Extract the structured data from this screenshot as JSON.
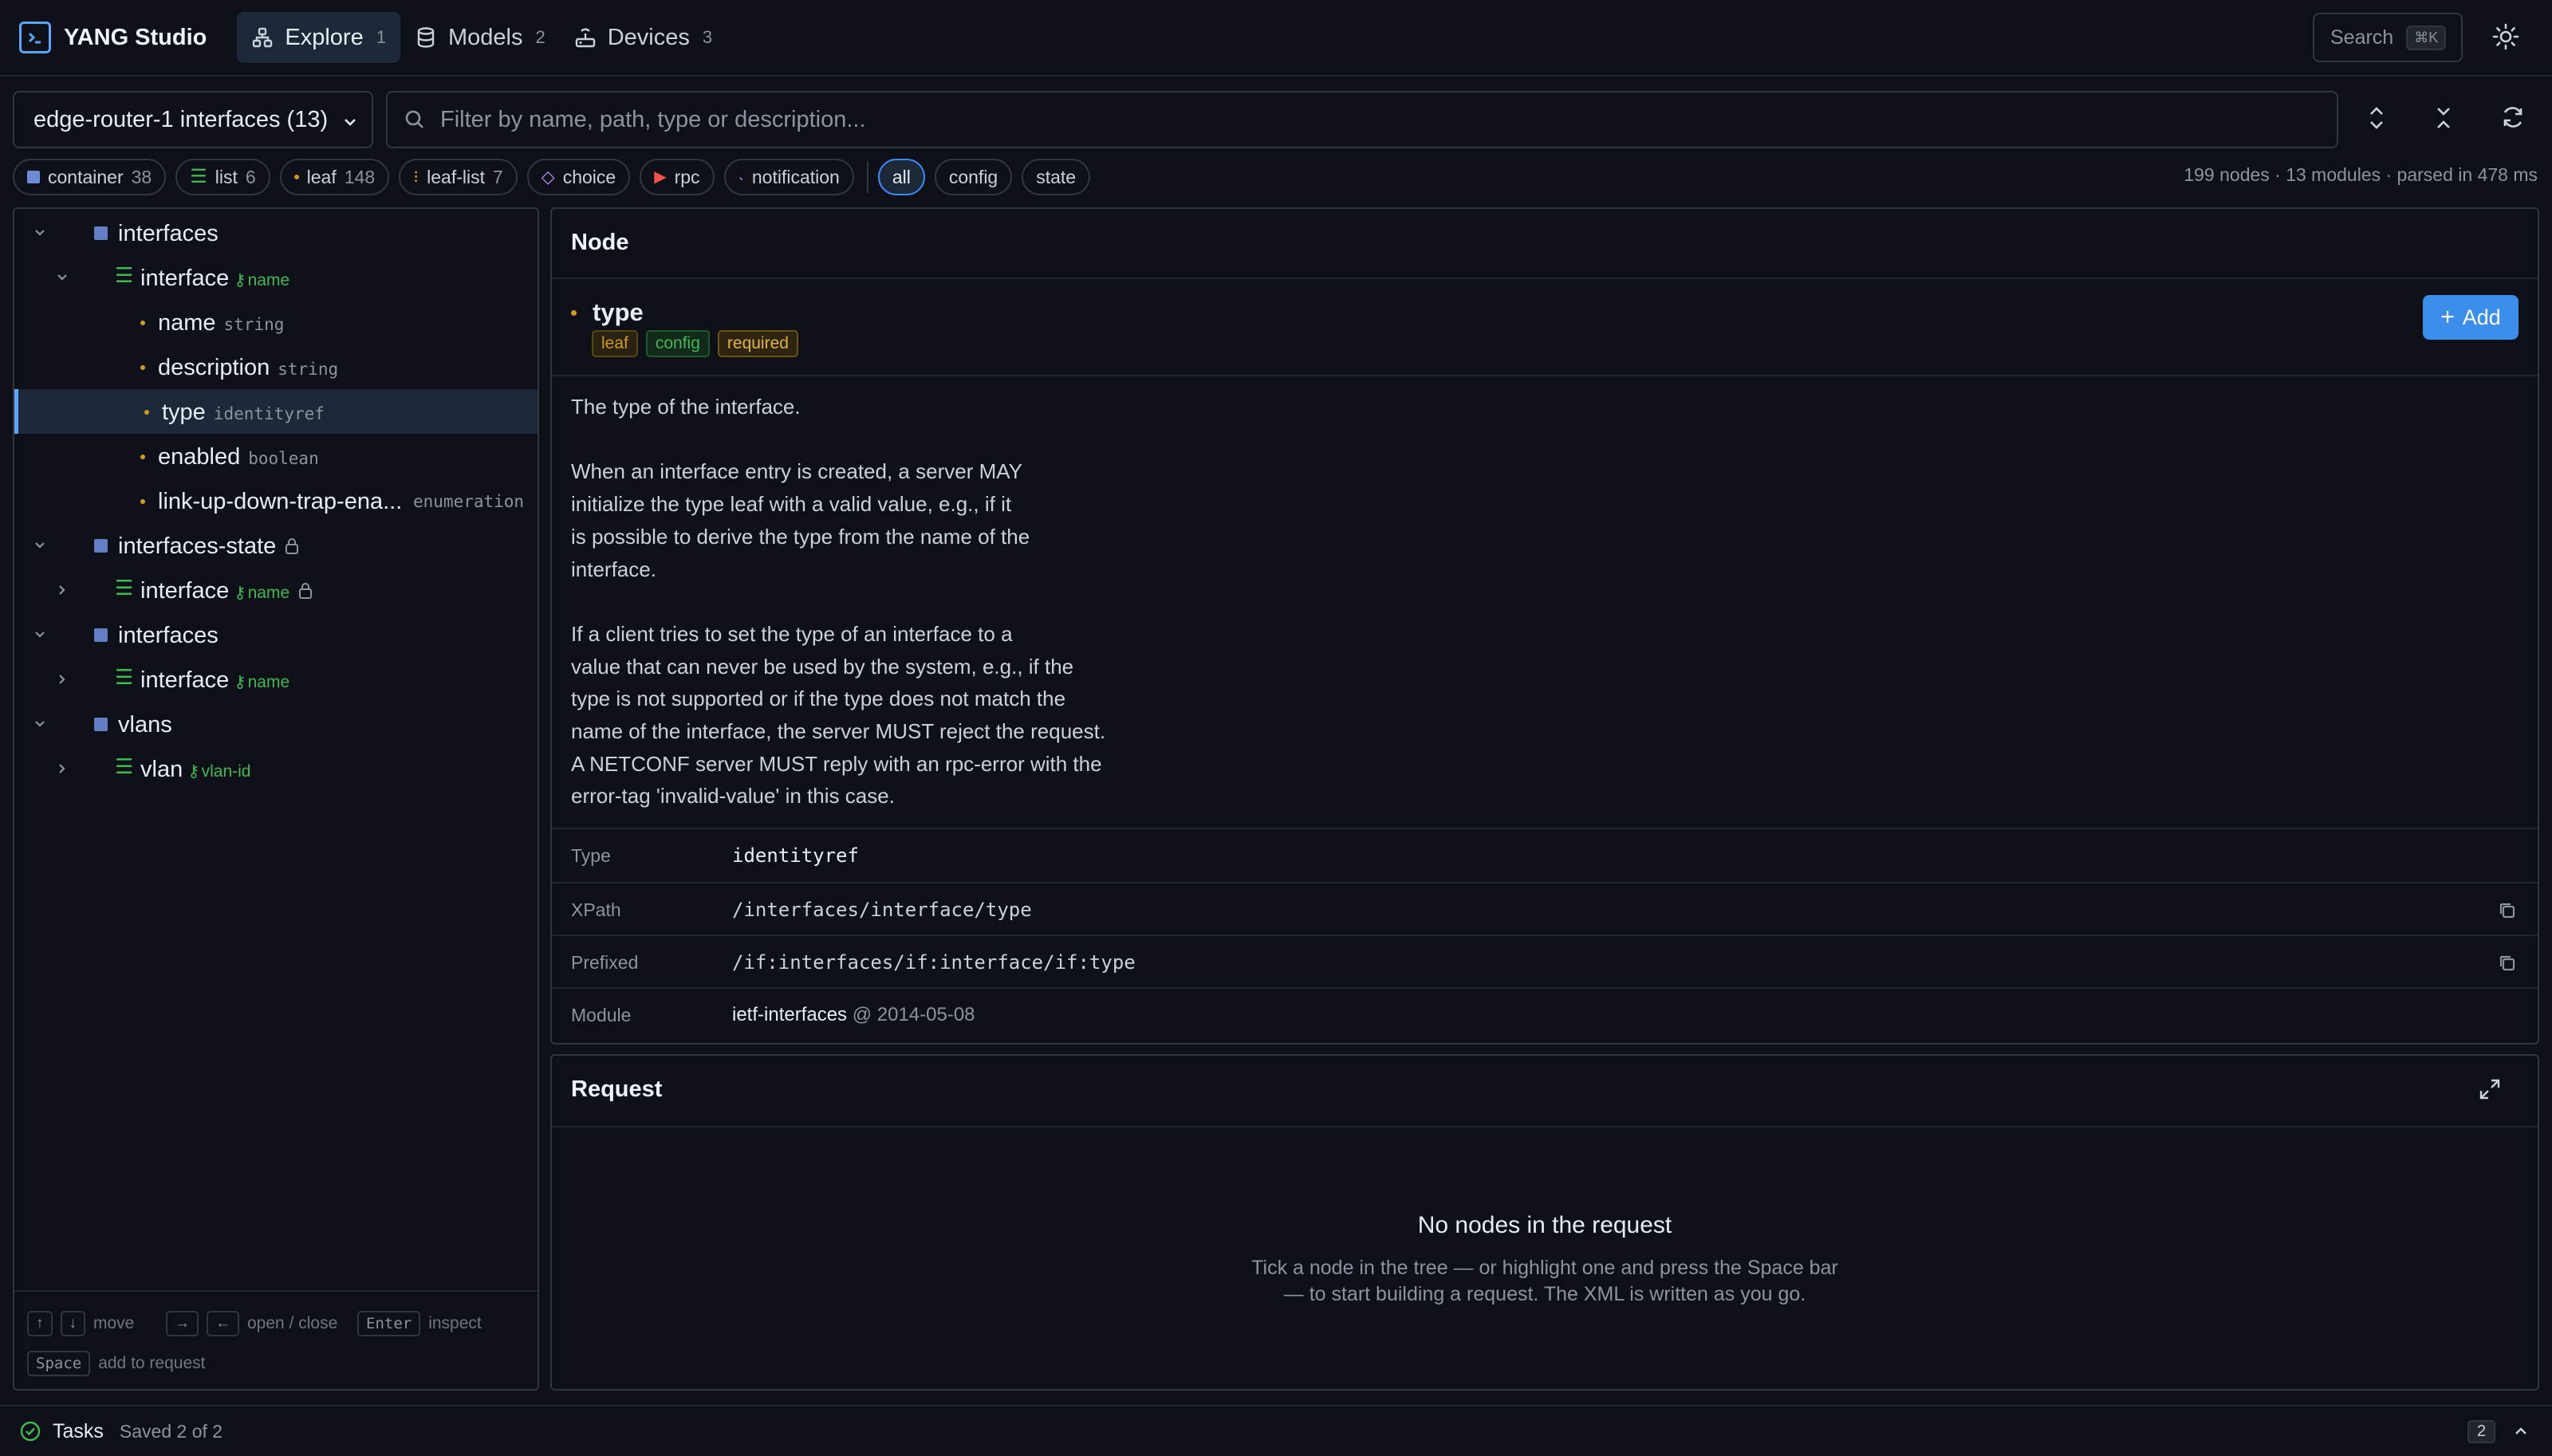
{
  "app": {
    "title": "YANG Studio"
  },
  "nav": {
    "tabs": [
      {
        "label": "Explore",
        "count": "1",
        "icon": "tree-icon"
      },
      {
        "label": "Models",
        "count": "2",
        "icon": "database-icon"
      },
      {
        "label": "Devices",
        "count": "3",
        "icon": "router-icon"
      }
    ],
    "search_label": "Search",
    "search_shortcut": "⌘K"
  },
  "toolbar": {
    "scope_select": "edge-router-1 interfaces (13)",
    "filter_placeholder": "Filter by name, path, type or description..."
  },
  "chips": {
    "kinds": [
      {
        "label": "container",
        "count": "38"
      },
      {
        "label": "list",
        "count": "6"
      },
      {
        "label": "leaf",
        "count": "148"
      },
      {
        "label": "leaf-list",
        "count": "7"
      },
      {
        "label": "choice",
        "count": ""
      },
      {
        "label": "rpc",
        "count": ""
      },
      {
        "label": "notification",
        "count": ""
      }
    ],
    "modes": [
      "all",
      "config",
      "state"
    ],
    "active_mode": "all"
  },
  "stats": "199 nodes · 13 modules · parsed in 478 ms",
  "tree": {
    "rows": [
      {
        "name": "interfaces",
        "key": "",
        "type": ""
      },
      {
        "name": "interface",
        "key": "name",
        "type": ""
      },
      {
        "name": "name",
        "key": "",
        "type": "string"
      },
      {
        "name": "description",
        "key": "",
        "type": "string"
      },
      {
        "name": "type",
        "key": "",
        "type": "identityref"
      },
      {
        "name": "enabled",
        "key": "",
        "type": "boolean"
      },
      {
        "name": "link-up-down-trap-ena...",
        "key": "",
        "type": "enumeration"
      },
      {
        "name": "interfaces-state",
        "key": "",
        "type": ""
      },
      {
        "name": "interface",
        "key": "name",
        "type": ""
      },
      {
        "name": "interfaces",
        "key": "",
        "type": ""
      },
      {
        "name": "interface",
        "key": "name",
        "type": ""
      },
      {
        "name": "vlans",
        "key": "",
        "type": ""
      },
      {
        "name": "vlan",
        "key": "vlan-id",
        "type": ""
      }
    ],
    "selected": "type",
    "hints": {
      "move": "move",
      "open_close": "open / close",
      "enter_key": "Enter",
      "inspect": "inspect",
      "space_key": "Space",
      "add": "add to request"
    }
  },
  "node": {
    "panel_title": "Node",
    "name": "type",
    "badges": [
      "leaf",
      "config",
      "required"
    ],
    "add_label": "Add",
    "description_lines": [
      "The type of the interface.",
      "",
      "When an interface entry is created, a server MAY",
      "initialize the type leaf with a valid value, e.g., if it",
      "is possible to derive the type from the name of the",
      "interface.",
      "",
      "If a client tries to set the type of an interface to a",
      "value that can never be used by the system, e.g., if the",
      "type is not supported or if the type does not match the",
      "name of the interface, the server MUST reject the request.",
      "A NETCONF server MUST reply with an rpc-error with the",
      "error-tag 'invalid-value' in this case."
    ],
    "props": {
      "type_label": "Type",
      "type_value": "identityref",
      "xpath_label": "XPath",
      "xpath_value": "/interfaces/interface/type",
      "prefixed_label": "Prefixed",
      "prefixed_value": "/if:interfaces/if:interface/if:type",
      "module_label": "Module",
      "module_value": "ietf-interfaces",
      "module_rev": "@ 2014-05-08"
    }
  },
  "request": {
    "panel_title": "Request",
    "empty_title": "No nodes in the request",
    "empty_line1": "Tick a node in the tree — or highlight one and press the Space bar",
    "empty_line2": "— to start building a request. The XML is written as you go."
  },
  "tasks": {
    "label": "Tasks",
    "status": "Saved 2 of 2",
    "count": "2"
  },
  "colors": {
    "accent": "#58a6ff",
    "container": "#6e8bd8",
    "list": "#3fb950",
    "leaf": "#d29922",
    "rpc": "#f85149",
    "badge_leaf": "#d29922",
    "badge_config": "#3fb950",
    "badge_required": "#e3b341"
  }
}
